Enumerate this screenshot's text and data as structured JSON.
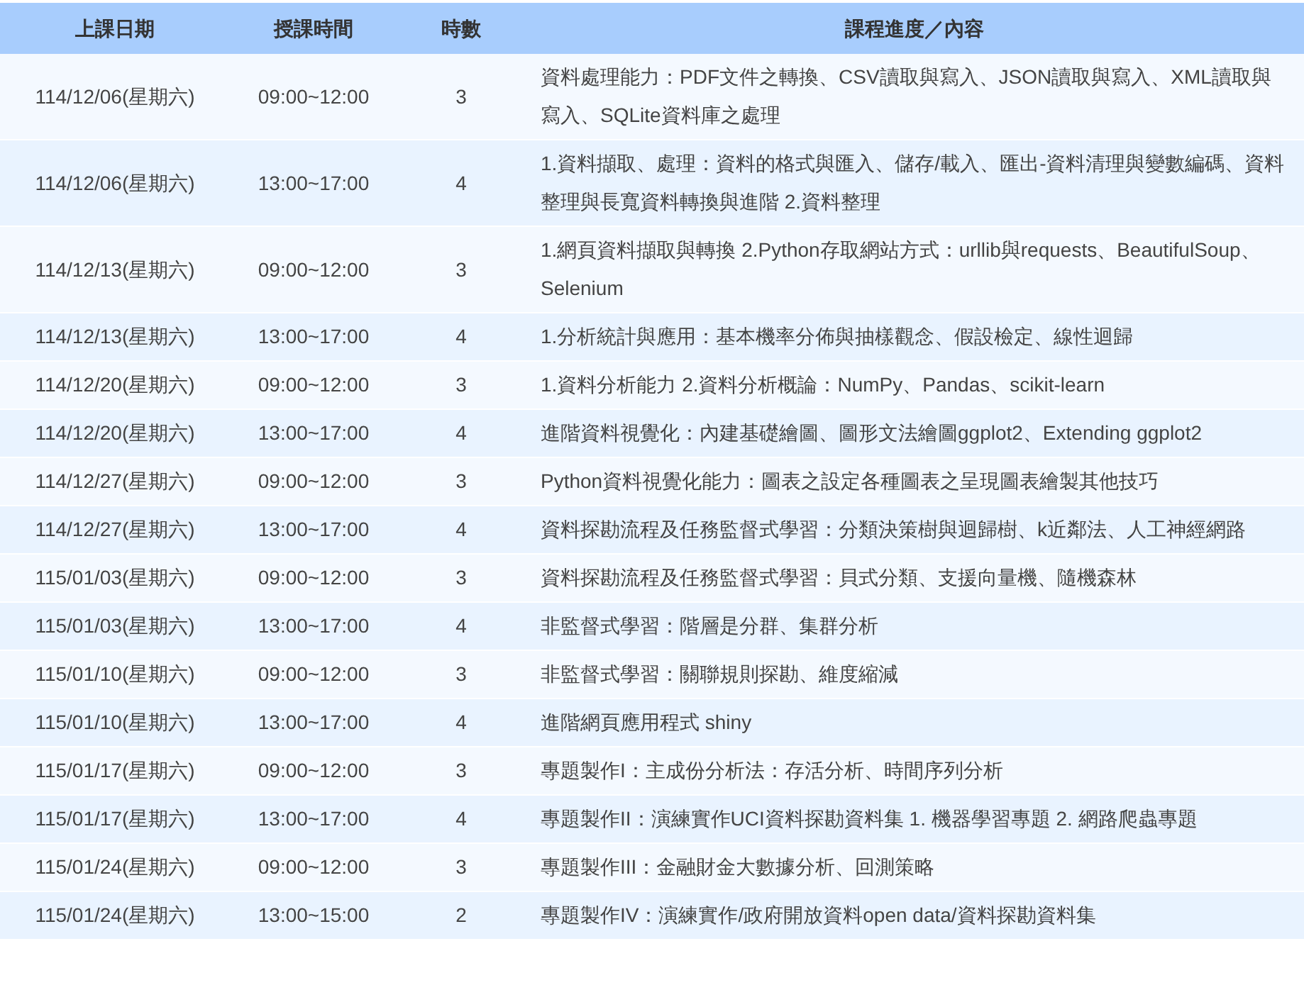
{
  "table": {
    "columns": [
      "上課日期",
      "授課時間",
      "時數",
      "課程進度／內容"
    ],
    "rows": [
      {
        "date": "114/12/06(星期六)",
        "time": "09:00~12:00",
        "hours": "3",
        "content": "資料處理能力：PDF文件之轉換、CSV讀取與寫入、JSON讀取與寫入、XML讀取與寫入、SQLite資料庫之處理"
      },
      {
        "date": "114/12/06(星期六)",
        "time": "13:00~17:00",
        "hours": "4",
        "content": "1.資料擷取、處理：資料的格式與匯入、儲存/載入、匯出-資料清理與變數編碼、資料整理與長寬資料轉換與進階 2.資料整理"
      },
      {
        "date": "114/12/13(星期六)",
        "time": "09:00~12:00",
        "hours": "3",
        "content": "1.網頁資料擷取與轉換 2.Python存取網站方式：urllib與requests、BeautifulSoup、Selenium"
      },
      {
        "date": "114/12/13(星期六)",
        "time": "13:00~17:00",
        "hours": "4",
        "content": "1.分析統計與應用：基本機率分佈與抽樣觀念、假設檢定、線性迴歸"
      },
      {
        "date": "114/12/20(星期六)",
        "time": "09:00~12:00",
        "hours": "3",
        "content": "1.資料分析能力 2.資料分析概論：NumPy、Pandas、scikit-learn"
      },
      {
        "date": "114/12/20(星期六)",
        "time": "13:00~17:00",
        "hours": "4",
        "content": "進階資料視覺化：內建基礎繪圖、圖形文法繪圖ggplot2、Extending ggplot2"
      },
      {
        "date": "114/12/27(星期六)",
        "time": "09:00~12:00",
        "hours": "3",
        "content": "Python資料視覺化能力：圖表之設定各種圖表之呈現圖表繪製其他技巧"
      },
      {
        "date": "114/12/27(星期六)",
        "time": "13:00~17:00",
        "hours": "4",
        "content": "資料探勘流程及任務監督式學習：分類決策樹與迴歸樹、k近鄰法、人工神經網路"
      },
      {
        "date": "115/01/03(星期六)",
        "time": "09:00~12:00",
        "hours": "3",
        "content": "資料探勘流程及任務監督式學習：貝式分類、支援向量機、隨機森林"
      },
      {
        "date": "115/01/03(星期六)",
        "time": "13:00~17:00",
        "hours": "4",
        "content": "非監督式學習：階層是分群、集群分析"
      },
      {
        "date": "115/01/10(星期六)",
        "time": "09:00~12:00",
        "hours": "3",
        "content": "非監督式學習：關聯規則探勘、維度縮減"
      },
      {
        "date": "115/01/10(星期六)",
        "time": "13:00~17:00",
        "hours": "4",
        "content": "進階網頁應用程式 shiny"
      },
      {
        "date": "115/01/17(星期六)",
        "time": "09:00~12:00",
        "hours": "3",
        "content": "專題製作I：主成份分析法：存活分析、時間序列分析"
      },
      {
        "date": "115/01/17(星期六)",
        "time": "13:00~17:00",
        "hours": "4",
        "content": "專題製作II：演練實作UCI資料探勘資料集 1. 機器學習專題 2. 網路爬蟲專題"
      },
      {
        "date": "115/01/24(星期六)",
        "time": "09:00~12:00",
        "hours": "3",
        "content": "專題製作III：金融財金大數據分析、回測策略"
      },
      {
        "date": "115/01/24(星期六)",
        "time": "13:00~15:00",
        "hours": "2",
        "content": "專題製作IV：演練實作/政府開放資料open data/資料探勘資料集"
      }
    ]
  }
}
